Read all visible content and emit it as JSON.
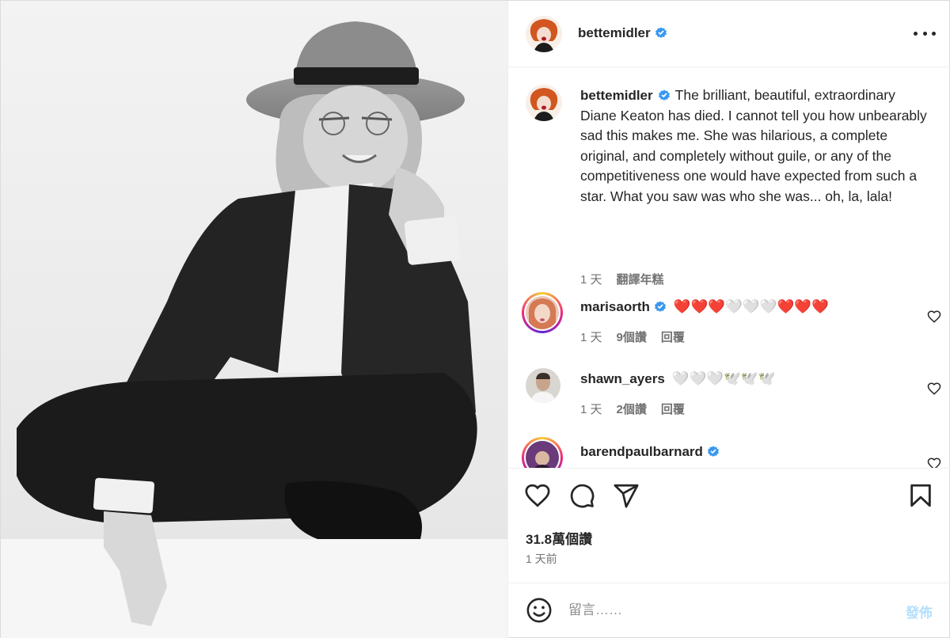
{
  "colors": {
    "verified": "#3897f0",
    "accent": "#0095f6",
    "post_disabled": "#b2dffc",
    "muted": "#737373"
  },
  "post": {
    "author": "bettemidler",
    "verified": true,
    "photo_alt": "Black and white photo of Diane Keaton in a wide-brim hat and dark suit sitting cross-legged"
  },
  "caption": {
    "username": "bettemidler",
    "text": "The brilliant, beautiful, extraordinary Diane Keaton has died. I cannot tell you how unbearably sad this makes me. She was hilarious, a complete original, and completely without guile, or any of the competitiveness one would have expected from such a star. What you saw was who she was... oh, la, lala!",
    "time": "1 天",
    "translate": "翻譯年糕"
  },
  "comments": [
    {
      "username": "marisaorth",
      "verified": true,
      "text": "❤️❤️❤️🤍🤍🤍❤️❤️❤️",
      "time": "1 天",
      "likes": "9個讚",
      "reply": "回覆"
    },
    {
      "username": "shawn_ayers",
      "verified": false,
      "text": "🤍🤍🤍🕊️🕊️🕊️",
      "time": "1 天",
      "likes": "2個讚",
      "reply": "回覆"
    },
    {
      "username": "barendpaulbarnard",
      "verified": true,
      "text": "",
      "time": "",
      "likes": "",
      "reply": ""
    }
  ],
  "actions": {
    "like_count": "31.8萬個讚",
    "posted_ago": "1 天前"
  },
  "composer": {
    "placeholder": "留言……",
    "post_label": "發佈"
  },
  "icons": [
    "more-options-icon",
    "verified-badge-icon",
    "heart-icon",
    "comment-icon",
    "share-icon",
    "bookmark-icon",
    "emoji-icon"
  ]
}
